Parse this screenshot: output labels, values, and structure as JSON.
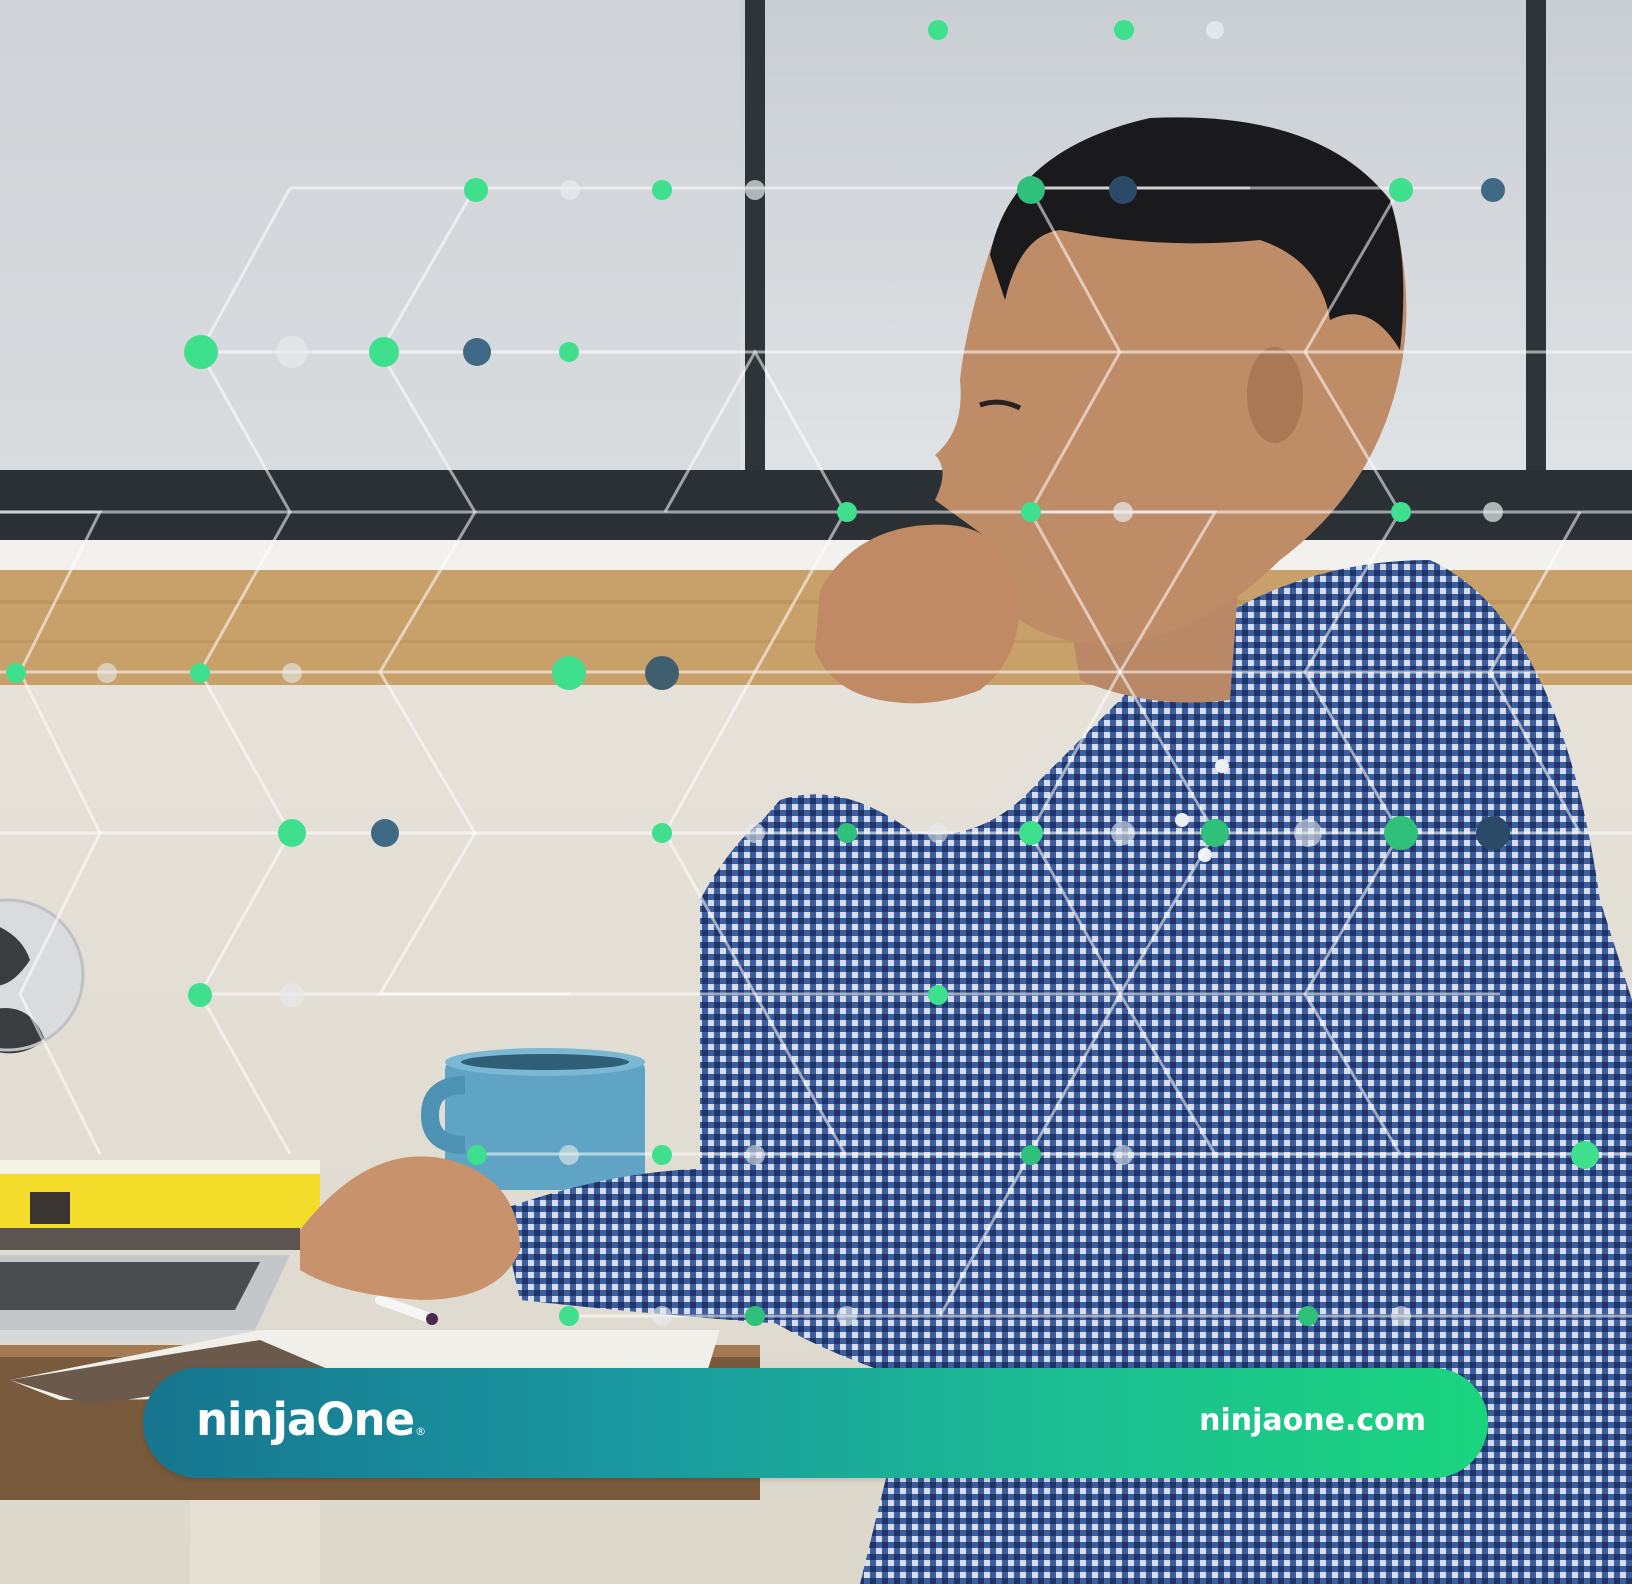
{
  "brand": {
    "logo_text": "ninjaOne",
    "logo_mark": "®",
    "website": "ninjaone.com",
    "gradient_start": "#17758f",
    "gradient_end": "#1ad47d"
  },
  "palette": {
    "dot_green": "#3ee08e",
    "dot_slate": "#3f6a85",
    "dot_white": "#e8ecee",
    "shirt_blue": "#3a5a9c"
  }
}
